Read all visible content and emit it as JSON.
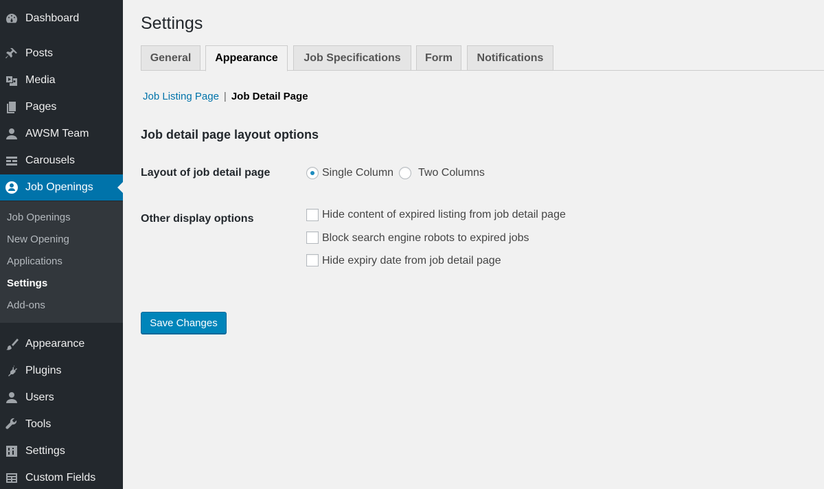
{
  "sidebar": {
    "items": [
      {
        "label": "Dashboard",
        "icon": "dashboard-icon"
      },
      {
        "label": "Posts",
        "icon": "pin-icon"
      },
      {
        "label": "Media",
        "icon": "media-icon"
      },
      {
        "label": "Pages",
        "icon": "pages-icon"
      },
      {
        "label": "AWSM Team",
        "icon": "user-icon"
      },
      {
        "label": "Carousels",
        "icon": "carousel-icon"
      },
      {
        "label": "Job Openings",
        "icon": "job-openings-icon"
      },
      {
        "label": "Appearance",
        "icon": "brush-icon"
      },
      {
        "label": "Plugins",
        "icon": "plug-icon"
      },
      {
        "label": "Users",
        "icon": "user-icon"
      },
      {
        "label": "Tools",
        "icon": "wrench-icon"
      },
      {
        "label": "Settings",
        "icon": "sliders-icon"
      },
      {
        "label": "Custom Fields",
        "icon": "grid-icon"
      }
    ],
    "submenu": [
      "Job Openings",
      "New Opening",
      "Applications",
      "Settings",
      "Add-ons"
    ],
    "active_submenu": "Settings"
  },
  "page": {
    "title": "Settings",
    "tabs": [
      "General",
      "Appearance",
      "Job Specifications",
      "Form",
      "Notifications"
    ],
    "active_tab": "Appearance",
    "subnav": {
      "link": "Job Listing Page",
      "separator": "|",
      "current": "Job Detail Page"
    },
    "section_title": "Job detail page layout options",
    "layout": {
      "label": "Layout of job detail page",
      "options": [
        "Single Column",
        "Two Columns"
      ],
      "selected": "Single Column"
    },
    "display": {
      "label": "Other display options",
      "options": [
        "Hide content of expired listing from job detail page",
        "Block search engine robots to expired jobs",
        "Hide expiry date from job detail page"
      ]
    },
    "save_label": "Save Changes"
  },
  "colors": {
    "accent": "#0073aa",
    "sidebar_bg": "#23282d",
    "submenu_bg": "#32373c",
    "button": "#0085ba"
  }
}
